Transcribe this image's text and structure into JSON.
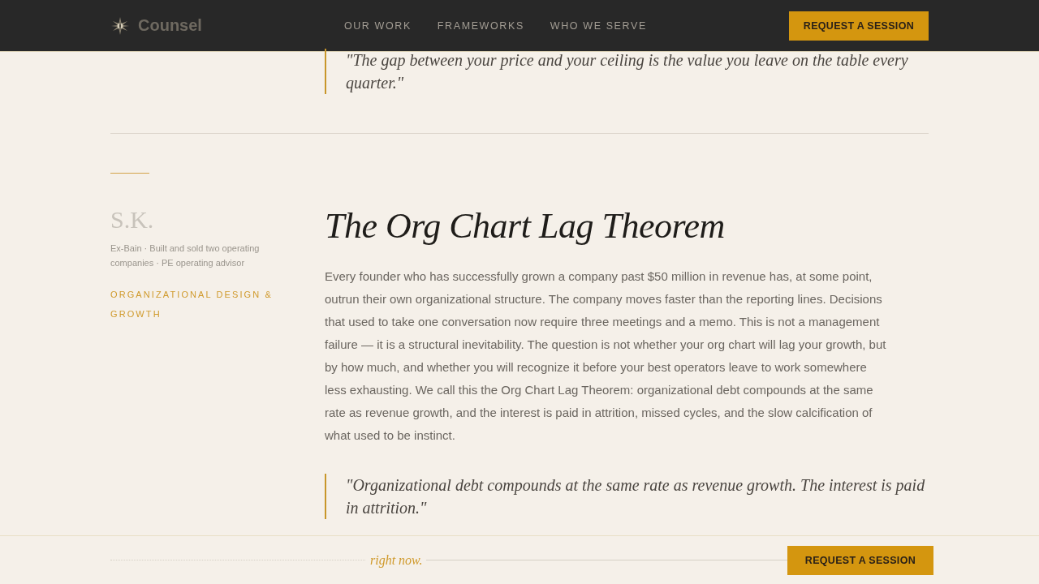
{
  "nav": {
    "brand": "Counsel",
    "links": [
      "OUR WORK",
      "FRAMEWORKS",
      "WHO WE SERVE"
    ],
    "cta": "REQUEST A SESSION"
  },
  "previous_quote": "\"The gap between your price and your ceiling is the value you leave on the table every quarter.\"",
  "article": {
    "author": "S.K.",
    "bio": "Ex-Bain · Built and sold two operating companies · PE operating advisor",
    "tag": "ORGANIZATIONAL DESIGN & GROWTH",
    "title": "The Org Chart Lag Theorem",
    "body": "Every founder who has successfully grown a company past $50 million in revenue has, at some point, outrun their own organizational structure. The company moves faster than the reporting lines. Decisions that used to take one conversation now require three meetings and a memo. This is not a management failure — it is a structural inevitability. The question is not whether your org chart will lag your growth, but by how much, and whether you will recognize it before your best operators leave to work somewhere less exhausting. We call this the Org Chart Lag Theorem: organizational debt compounds at the same rate as revenue growth, and the interest is paid in attrition, missed cycles, and the slow calcification of what used to be instinct.",
    "pull_quote": "\"Organizational debt compounds at the same rate as revenue growth. The interest is paid in attrition.\""
  },
  "sticky_bar": {
    "text": "right now.",
    "button": "REQUEST A SESSION"
  }
}
